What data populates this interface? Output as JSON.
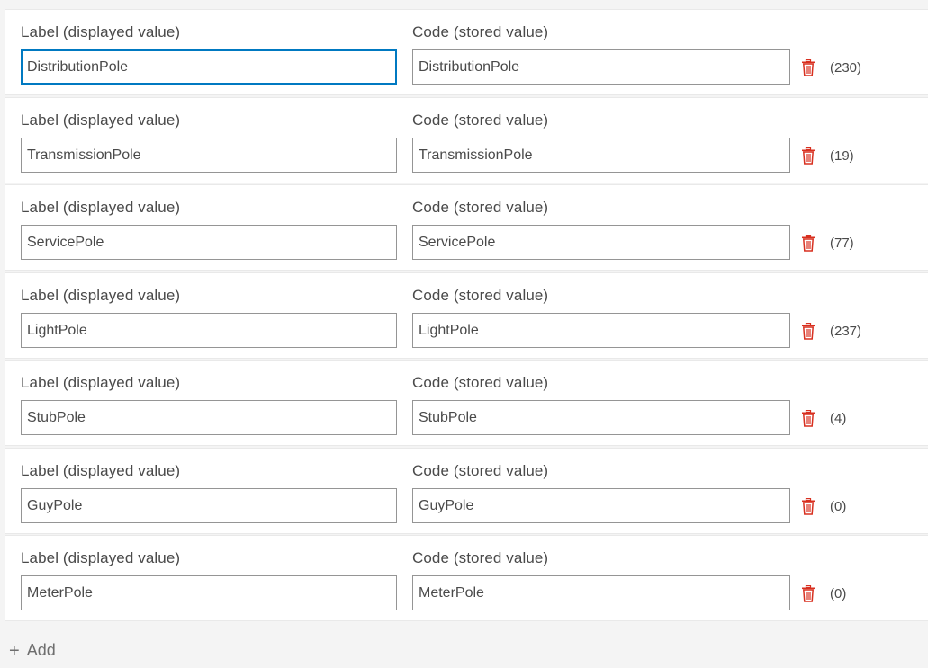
{
  "colors": {
    "accent": "#0079c1",
    "delete": "#d83020",
    "text": "#4a4a4a",
    "background": "#f4f4f4"
  },
  "rows": [
    {
      "label_heading": "Label (displayed value)",
      "code_heading": "Code (stored value)",
      "label_value": "DistributionPole",
      "code_value": "DistributionPole",
      "count": "(230)",
      "focused": true
    },
    {
      "label_heading": "Label (displayed value)",
      "code_heading": "Code (stored value)",
      "label_value": "TransmissionPole",
      "code_value": "TransmissionPole",
      "count": "(19)"
    },
    {
      "label_heading": "Label (displayed value)",
      "code_heading": "Code (stored value)",
      "label_value": "ServicePole",
      "code_value": "ServicePole",
      "count": "(77)"
    },
    {
      "label_heading": "Label (displayed value)",
      "code_heading": "Code (stored value)",
      "label_value": "LightPole",
      "code_value": "LightPole",
      "count": "(237)"
    },
    {
      "label_heading": "Label (displayed value)",
      "code_heading": "Code (stored value)",
      "label_value": "StubPole",
      "code_value": "StubPole",
      "count": "(4)"
    },
    {
      "label_heading": "Label (displayed value)",
      "code_heading": "Code (stored value)",
      "label_value": "GuyPole",
      "code_value": "GuyPole",
      "count": "(0)"
    },
    {
      "label_heading": "Label (displayed value)",
      "code_heading": "Code (stored value)",
      "label_value": "MeterPole",
      "code_value": "MeterPole",
      "count": "(0)"
    }
  ],
  "add": {
    "icon": "plus-icon",
    "label": "Add"
  }
}
